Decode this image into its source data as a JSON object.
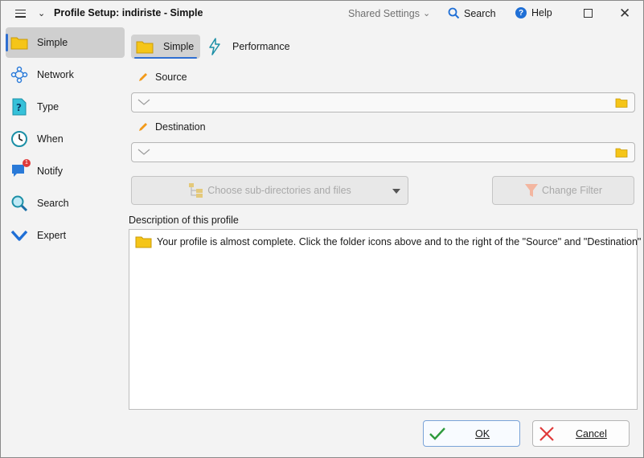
{
  "titlebar": {
    "title": "Profile Setup: indiriste - Simple",
    "shared_settings": "Shared Settings",
    "search": "Search",
    "help": "Help"
  },
  "sidebar": {
    "items": [
      {
        "label": "Simple",
        "icon": "folder-icon",
        "active": true
      },
      {
        "label": "Network",
        "icon": "network-icon",
        "active": false
      },
      {
        "label": "Type",
        "icon": "question-page-icon",
        "active": false
      },
      {
        "label": "When",
        "icon": "clock-icon",
        "active": false
      },
      {
        "label": "Notify",
        "icon": "chat-bubble-icon",
        "active": false,
        "badge": "1"
      },
      {
        "label": "Search",
        "icon": "magnifier-icon",
        "active": false
      },
      {
        "label": "Expert",
        "icon": "chevron-down-icon",
        "active": false
      }
    ]
  },
  "tabs": {
    "simple": "Simple",
    "performance": "Performance"
  },
  "source": {
    "label": "Source",
    "value": ""
  },
  "destination": {
    "label": "Destination",
    "value": ""
  },
  "buttons": {
    "choose_subdirs": "Choose sub-directories and files",
    "change_filter": "Change Filter",
    "ok": "OK",
    "cancel": "Cancel"
  },
  "description": {
    "label": "Description of this profile",
    "text": "Your profile is almost complete. Click the folder icons above and to the right of the \"Source\" and \"Destination\" ..."
  },
  "colors": {
    "accent": "#2f6fd1",
    "folder": "#f5c518",
    "ok_check": "#2e9a3c",
    "cancel_x": "#e03a3a"
  }
}
